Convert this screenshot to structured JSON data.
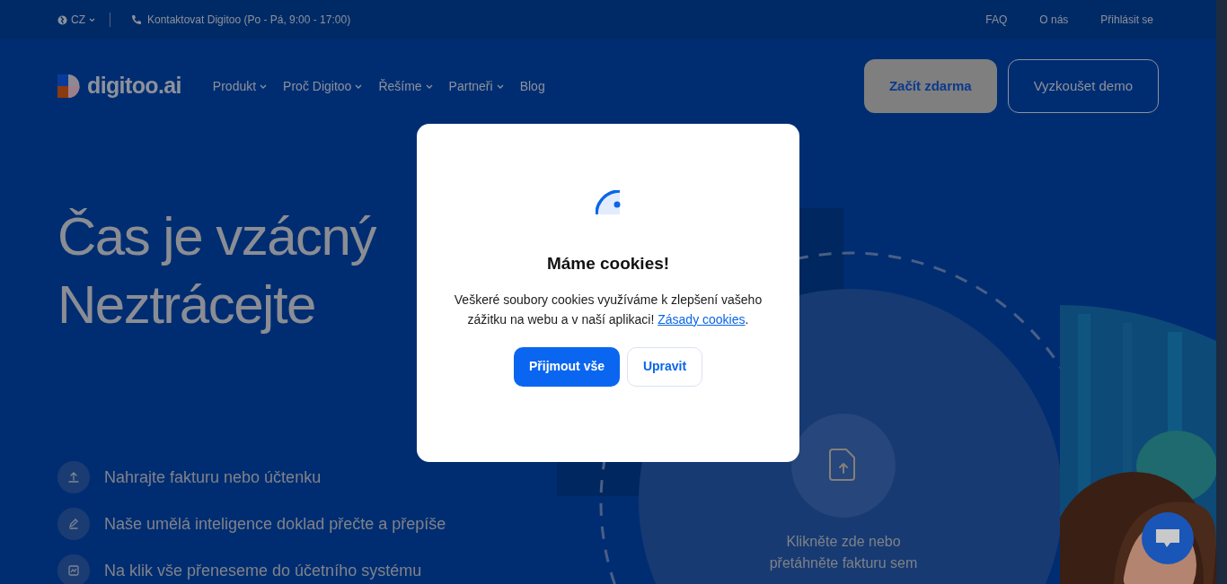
{
  "top_bar": {
    "language": "CZ",
    "contact": "Kontaktovat Digitoo (Po - Pá, 9:00 - 17:00)",
    "links": [
      "FAQ",
      "O nás",
      "Přihlásit se"
    ]
  },
  "nav": {
    "logo": "digitoo.ai",
    "items": [
      {
        "label": "Produkt",
        "dropdown": true
      },
      {
        "label": "Proč Digitoo",
        "dropdown": true
      },
      {
        "label": "Řešíme",
        "dropdown": true
      },
      {
        "label": "Partneři",
        "dropdown": true
      },
      {
        "label": "Blog",
        "dropdown": false
      }
    ],
    "buttons": [
      {
        "label": "Začít zdarma",
        "kind": "primary"
      },
      {
        "label": "Vyzkoušet demo",
        "kind": "outline"
      }
    ]
  },
  "hero": {
    "heading": [
      "Čas je vzácný",
      "Neztrácejte"
    ],
    "features": [
      {
        "kind": "upload",
        "text": "Nahrajte fakturu nebo účtenku"
      },
      {
        "kind": "edit",
        "text": "Naše umělá inteligence doklad přečte a přepíše"
      },
      {
        "kind": "transfer",
        "text": "Na klik vše přeneseme do účetního systému"
      }
    ],
    "upload": {
      "text": [
        "Klikněte zde nebo",
        "přetáhněte fakturu sem"
      ]
    },
    "photo": {
      "kind": "picture"
    }
  },
  "cookie_dialog": {
    "title": "Máme cookies!",
    "text": "Veškeré soubory cookies využíváme k zlepšení vašeho zážitku na webu a v naší aplikaci! ",
    "link": "Zásady cookies",
    "after_link": ".",
    "buttons": [
      {
        "label": "Přijmout vše",
        "kind": "primary"
      },
      {
        "label": "Upravit",
        "kind": "outline"
      }
    ]
  }
}
